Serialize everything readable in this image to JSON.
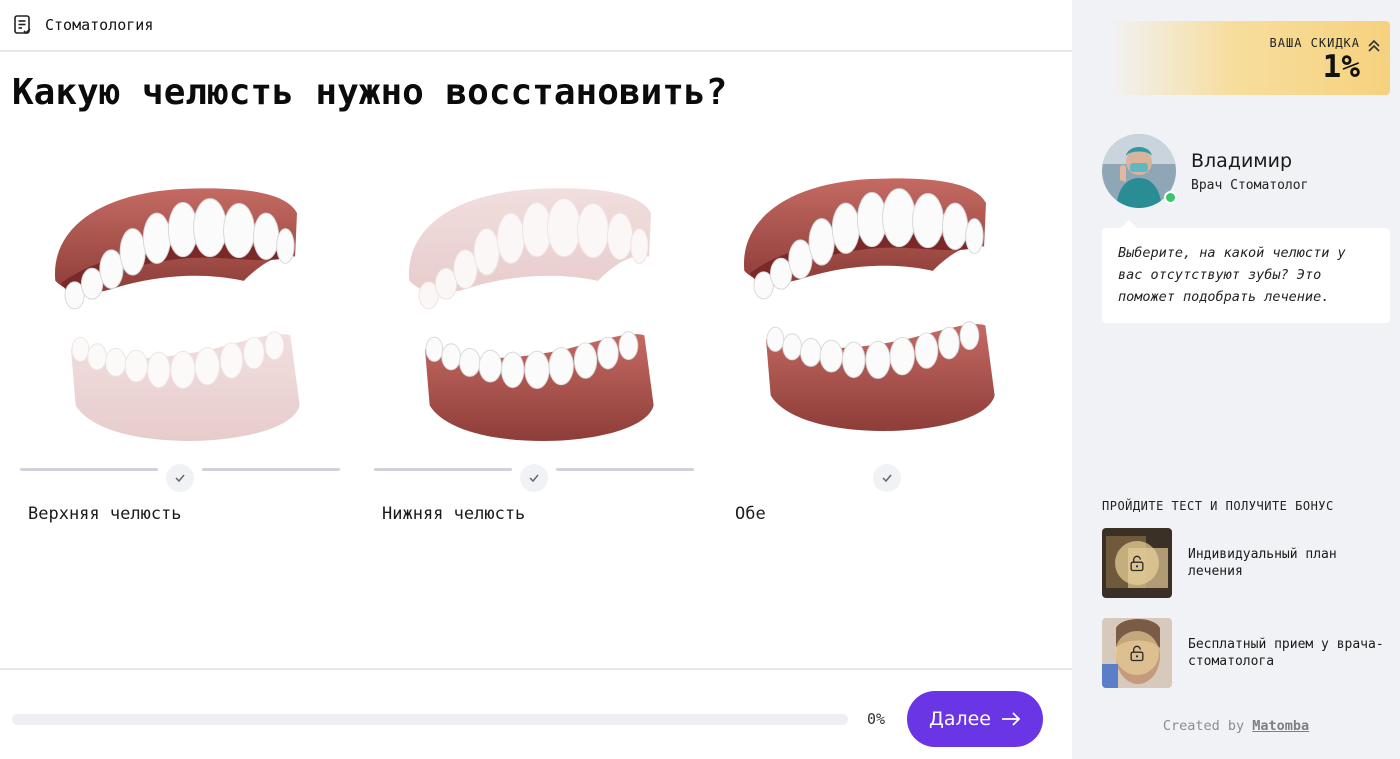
{
  "header": {
    "icon": "document-list-icon",
    "title": "Стоматология"
  },
  "question": "Какую челюсть нужно восстановить?",
  "options": [
    {
      "label": "Верхняя челюсть",
      "image": "upper-jaw-highlighted"
    },
    {
      "label": "Нижняя челюсть",
      "image": "lower-jaw-highlighted"
    },
    {
      "label": "Обе",
      "image": "both-jaws-highlighted"
    }
  ],
  "footer": {
    "progress": 0,
    "progress_text": "0%",
    "next_label": "Далее",
    "next_icon": "arrow-right-icon"
  },
  "sidebar": {
    "discount_label": "ВАША СКИДКА",
    "discount_value": "1%",
    "expert_name": "Владимир",
    "expert_role": "Врач Стоматолог",
    "message": "Выберите, на какой челюсти у вас отсутствуют зубы? Это поможет подобрать лечение.",
    "bonus_title": "ПРОЙДИТЕ ТЕСТ И ПОЛУЧИТЕ БОНУС",
    "bonuses": [
      {
        "text": "Индивидуальный план лечения",
        "icon": "lock-icon"
      },
      {
        "text": "Бесплатный прием у врача-стоматолога",
        "icon": "lock-icon"
      }
    ],
    "created_prefix": "Created by",
    "created_brand": "Matomba"
  },
  "colors": {
    "accent": "#6a35e5",
    "gum": "#a9564f",
    "gum_faded": "#e8cfcf",
    "discount": "#f6d27e",
    "online": "#37c76a"
  }
}
